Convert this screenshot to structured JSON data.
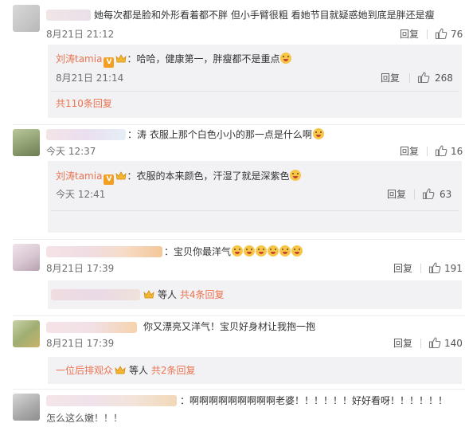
{
  "comments": [
    {
      "text": "她每次都是脸和外形看着都不胖  但小手臂很粗  看她节目就疑惑她到底是胖还是瘦",
      "time": "8月21日 21:12",
      "reply_label": "回复",
      "likes": "76",
      "replies": [
        {
          "author": "刘涛tamia",
          "text": "：哈哈，健康第一，胖瘦都不是重点",
          "time": "8月21日 21:14",
          "reply_label": "回复",
          "likes": "268"
        }
      ],
      "more_replies": "共110条回复"
    },
    {
      "text": "：涛  衣服上那个白色小小的那一点是什么啊",
      "time": "今天 12:37",
      "reply_label": "回复",
      "likes": "16",
      "replies": [
        {
          "author": "刘涛tamia",
          "text": "：衣服的本来颜色，汗湿了就是深紫色",
          "time": "今天 12:41",
          "reply_label": "回复",
          "likes": "63"
        }
      ]
    },
    {
      "text": "：宝贝你最洋气",
      "time": "8月21日 17:39",
      "reply_label": "回复",
      "likes": "191",
      "more_replies_prefix": "等人",
      "more_replies": "共4条回复"
    },
    {
      "text": "你又漂亮又洋气！宝贝好身材让我抱一抱",
      "time": "8月21日 17:39",
      "reply_label": "回复",
      "likes": "140",
      "more_replies_user": "一位后排观众",
      "more_replies_prefix": "等人",
      "more_replies": "共2条回复"
    },
    {
      "text": "：啊啊啊啊啊啊啊啊啊老婆！！！！！！好好看呀！！！！！！",
      "text2": "怎么这么嫩！！！"
    }
  ],
  "icons": {
    "like": "thumbs-up-icon",
    "verified": "orange-v-badge-icon",
    "crown": "crown-badge-icon",
    "emoji": "smiley-emoji-icon"
  },
  "colors": {
    "accent": "#eb7350",
    "reply_bg": "#f2f2f5",
    "verified": "#f2a024"
  }
}
